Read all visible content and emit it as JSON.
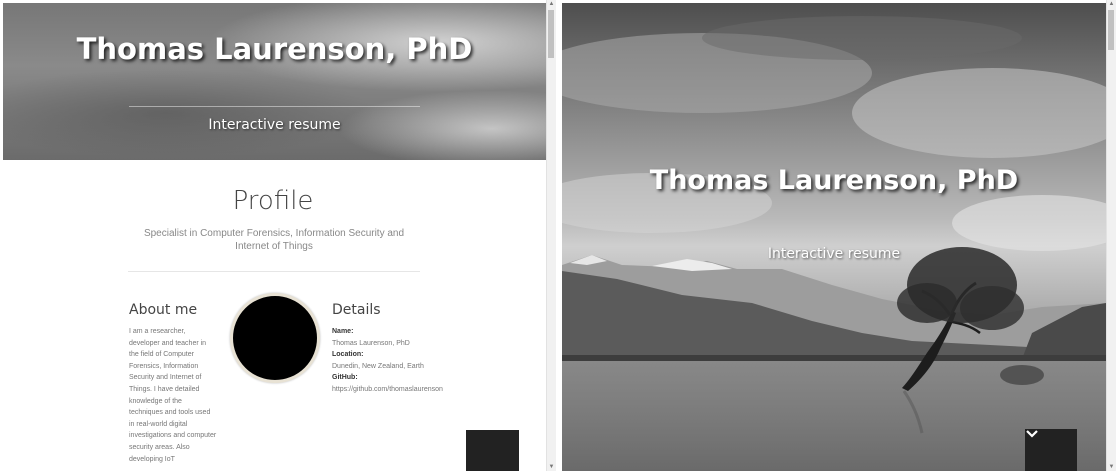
{
  "left": {
    "header": {
      "name": "Thomas Laurenson, PhD",
      "tagline": "Interactive resume"
    },
    "profile": {
      "title": "Profile",
      "subtitle": "Specialist in Computer Forensics, Information Security and Internet of Things"
    },
    "about": {
      "heading": "About me",
      "text": "I am a researcher, developer and teacher in the field of Computer Forensics, Information Security and Internet of Things. I have detailed knowledge of the techniques and tools used in real-world digital investigations and computer security areas. Also developing IoT"
    },
    "details": {
      "heading": "Details",
      "name_label": "Name:",
      "name_value": "Thomas Laurenson, PhD",
      "location_label": "Location:",
      "location_value": "Dunedin, New Zealand, Earth",
      "github_label": "GitHub:",
      "github_value": "https://github.com/thomaslaurenson"
    }
  },
  "right": {
    "header": {
      "name": "Thomas Laurenson, PhD",
      "tagline": "Interactive resume"
    },
    "scroll_button_icon": "chevron-down-icon"
  },
  "colors": {
    "dark_button": "#222222",
    "title_text": "#444444",
    "muted_text": "#888888"
  }
}
